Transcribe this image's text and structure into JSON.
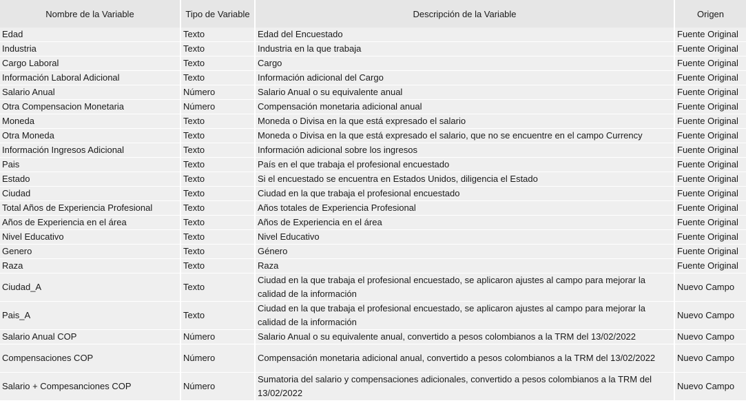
{
  "headers": {
    "name": "Nombre de la Variable",
    "type": "Tipo de Variable",
    "description": "Descripción de la Variable",
    "origin": "Origen"
  },
  "rows": [
    {
      "name": "Edad",
      "type": "Texto",
      "description": "Edad del Encuestado",
      "origin": "Fuente Original"
    },
    {
      "name": "Industria",
      "type": "Texto",
      "description": "Industria en la que trabaja",
      "origin": "Fuente Original"
    },
    {
      "name": "Cargo Laboral",
      "type": "Texto",
      "description": "Cargo",
      "origin": "Fuente Original"
    },
    {
      "name": "Información Laboral Adicional",
      "type": "Texto",
      "description": "Información adicional del Cargo",
      "origin": "Fuente Original"
    },
    {
      "name": "Salario Anual",
      "type": "Número",
      "description": "Salario Anual o su equivalente anual",
      "origin": "Fuente Original"
    },
    {
      "name": "Otra Compensacion Monetaria",
      "type": "Número",
      "description": "Compensación monetaria adicional anual",
      "origin": "Fuente Original"
    },
    {
      "name": "Moneda",
      "type": "Texto",
      "description": "Moneda o Divisa en la que está expresado el salario",
      "origin": "Fuente Original"
    },
    {
      "name": "Otra Moneda",
      "type": "Texto",
      "description": "Moneda o Divisa en la que está expresado el salario, que no se encuentre en el campo Currency",
      "origin": "Fuente Original"
    },
    {
      "name": "Información Ingresos Adicional",
      "type": "Texto",
      "description": "Información adicional sobre los ingresos",
      "origin": "Fuente Original"
    },
    {
      "name": "Pais",
      "type": "Texto",
      "description": "País en el que trabaja el profesional encuestado",
      "origin": "Fuente Original"
    },
    {
      "name": "Estado",
      "type": "Texto",
      "description": "Si el encuestado se encuentra en Estados Unidos, diligencia el Estado",
      "origin": "Fuente Original"
    },
    {
      "name": "Ciudad",
      "type": "Texto",
      "description": "Ciudad en la que trabaja el profesional encuestado",
      "origin": "Fuente Original"
    },
    {
      "name": "Total Años de Experiencia Profesional",
      "type": "Texto",
      "description": "Años totales de Experiencia Profesional",
      "origin": "Fuente Original"
    },
    {
      "name": "Años de Experiencia en el área",
      "type": "Texto",
      "description": "Años de Experiencia en el área",
      "origin": "Fuente Original"
    },
    {
      "name": "Nivel Educativo",
      "type": "Texto",
      "description": "Nivel Educativo",
      "origin": "Fuente Original"
    },
    {
      "name": "Genero",
      "type": "Texto",
      "description": "Género",
      "origin": "Fuente Original"
    },
    {
      "name": "Raza",
      "type": "Texto",
      "description": "Raza",
      "origin": "Fuente Original"
    },
    {
      "name": "Ciudad_A",
      "type": "Texto",
      "description": "Ciudad en la que trabaja el profesional encuestado, se aplicaron ajustes al campo para mejorar la calidad de la información",
      "origin": "Nuevo Campo",
      "tall": true
    },
    {
      "name": "Pais_A",
      "type": "Texto",
      "description": "Ciudad en la que trabaja el profesional encuestado, se aplicaron ajustes al campo para mejorar la calidad de la información",
      "origin": "Nuevo Campo",
      "tall": true
    },
    {
      "name": "Salario Anual COP",
      "type": "Número",
      "description": "Salario Anual o su equivalente anual, convertido a pesos colombianos a la TRM del 13/02/2022",
      "origin": "Nuevo Campo"
    },
    {
      "name": "Compensaciones COP",
      "type": "Número",
      "description": "Compensación monetaria adicional anual, convertido a pesos colombianos a la TRM del 13/02/2022",
      "origin": "Nuevo Campo",
      "tall": true
    },
    {
      "name": "Salario + Compesanciones COP",
      "type": "Número",
      "description": "Sumatoria del salario y compensaciones adicionales, convertido a pesos colombianos a la TRM del 13/02/2022",
      "origin": "Nuevo Campo",
      "tall": true
    }
  ]
}
